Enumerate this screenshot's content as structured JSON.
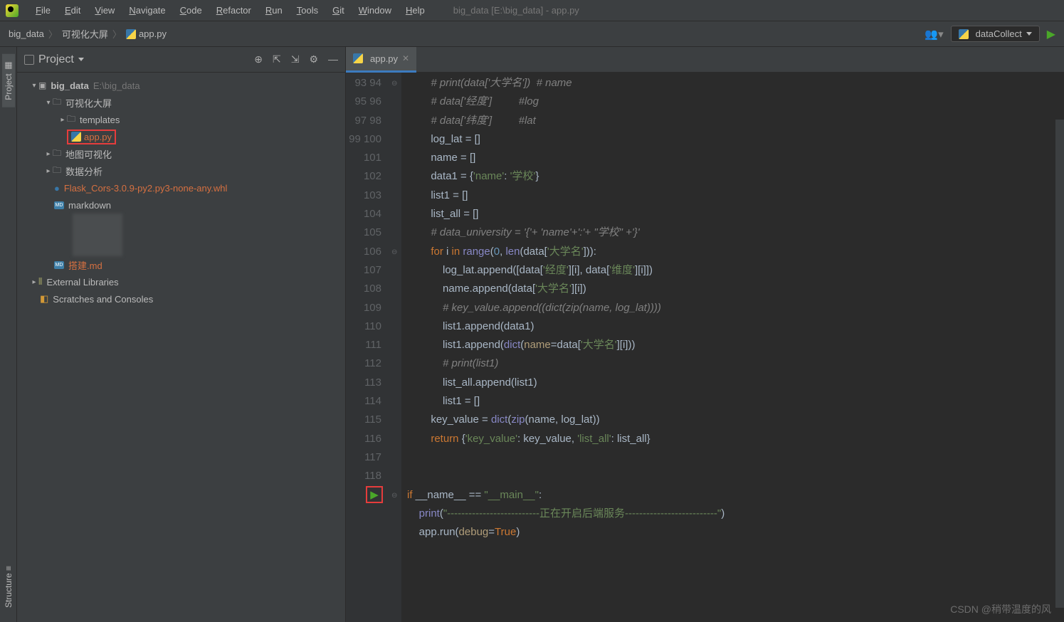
{
  "menu": {
    "items": [
      "File",
      "Edit",
      "View",
      "Navigate",
      "Code",
      "Refactor",
      "Run",
      "Tools",
      "Git",
      "Window",
      "Help"
    ]
  },
  "title": "big_data [E:\\big_data] - app.py",
  "breadcrumbs": {
    "root": "big_data",
    "mid": "可视化大屏",
    "file": "app.py"
  },
  "runConfig": "dataCollect",
  "project": {
    "title": "Project",
    "root": {
      "name": "big_data",
      "path": "E:\\big_data"
    },
    "visFolder": "可视化大屏",
    "templates": "templates",
    "app": "app.py",
    "mapVis": "地图可视化",
    "dataAnalysis": "数据分析",
    "whl": "Flask_Cors-3.0.9-py2.py3-none-any.whl",
    "markdown": "markdown",
    "build": "搭建.md",
    "extLib": "External Libraries",
    "scratches": "Scratches and Consoles"
  },
  "rails": {
    "project": "Project",
    "structure": "Structure"
  },
  "tab": "app.py",
  "lines": {
    "start": 93,
    "end": 118
  },
  "watermark": "CSDN @稍带温度的风",
  "code": [
    {
      "t": "comment",
      "s": "# print(data['大学名'])  # name"
    },
    {
      "t": "comment",
      "s": "# data['经度']         #log"
    },
    {
      "t": "comment",
      "s": "# data['纬度']         #lat"
    },
    {
      "t": "raw",
      "s": "log_lat = []"
    },
    {
      "t": "raw",
      "s": "name = []"
    },
    {
      "t": "dict1",
      "s": "data1 = {'name': '学校'}"
    },
    {
      "t": "raw",
      "s": "list1 = []"
    },
    {
      "t": "raw",
      "s": "list_all = []"
    },
    {
      "t": "comment",
      "s": "# data_university = '{'+ 'name'+':'+ \"学校\" +'}'"
    },
    {
      "t": "for",
      "s": "for i in range(0, len(data['大学名'])):"
    },
    {
      "t": "append1",
      "s": "    log_lat.append([data['经度'][i], data['维度'][i]])"
    },
    {
      "t": "append2",
      "s": "    name.append(data['大学名'][i])"
    },
    {
      "t": "comment2",
      "s": "    # key_value.append((dict(zip(name, log_lat))))"
    },
    {
      "t": "l1a",
      "s": "    list1.append(data1)"
    },
    {
      "t": "l1b",
      "s": "    list1.append(dict(name=data['大学名'][i]))"
    },
    {
      "t": "comment2",
      "s": "    # print(list1)"
    },
    {
      "t": "lall",
      "s": "    list_all.append(list1)"
    },
    {
      "t": "raw2",
      "s": "    list1 = []"
    },
    {
      "t": "kv",
      "s": "key_value = dict(zip(name, log_lat))"
    },
    {
      "t": "ret",
      "s": "return {'key_value': key_value, 'list_all': list_all}"
    },
    {
      "t": "blank",
      "s": ""
    },
    {
      "t": "blank",
      "s": ""
    },
    {
      "t": "main",
      "s": "if __name__ == \"__main__\":"
    },
    {
      "t": "print",
      "s": "    print(\"--------------------------正在开启后端服务--------------------------\")"
    },
    {
      "t": "run",
      "s": "    app.run(debug=True)"
    },
    {
      "t": "blank",
      "s": ""
    }
  ]
}
